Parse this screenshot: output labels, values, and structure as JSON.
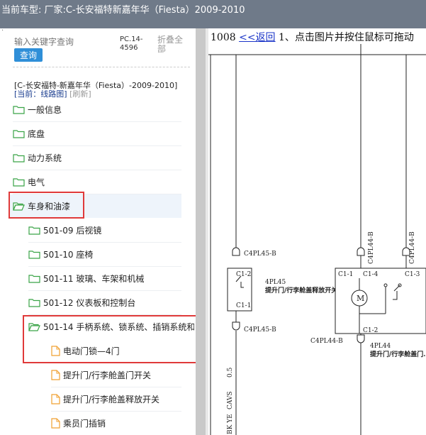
{
  "header": {
    "title": "当前车型:   厂家:C-长安福特新嘉年华（Fiesta）2009-2010"
  },
  "sidebar": {
    "dot": "·",
    "search": {
      "placeholder": "输入关键字查询",
      "button": "查询"
    },
    "pc_number": "PC.14-4596",
    "collapse_all": "折叠全部",
    "breadcrumb": "[C-长安福特-新嘉年华（Fiesta）-2009-2010]",
    "current_label": "[当前：线路图]",
    "refresh_label": "[刷新]",
    "tree": [
      {
        "label": "一般信息"
      },
      {
        "label": "底盘"
      },
      {
        "label": "动力系统"
      },
      {
        "label": "电气"
      },
      {
        "label": "车身和油漆"
      },
      {
        "label": "501-09 后视镜"
      },
      {
        "label": "501-10 座椅"
      },
      {
        "label": "501-11 玻璃、车架和机械"
      },
      {
        "label": "501-12 仪表板和控制台"
      },
      {
        "label": "501-14 手柄系统、锁系统、插销系统和…"
      },
      {
        "label": "电动门锁—4门"
      },
      {
        "label": "提升门/行李舱盖门开关"
      },
      {
        "label": "提升门/行李舱盖释放开关"
      },
      {
        "label": "乘员门插销"
      }
    ]
  },
  "content": {
    "page_no": "1008",
    "back_label": "<<返回",
    "instruction": "1、点击图片并按住鼠标可拖动"
  },
  "diagram": {
    "labels": {
      "c4pl45b_top": "C4PL45-B",
      "c4pl45b_bottom": "C4PL45-B",
      "c4pl44b_a": "C4PL44-B",
      "c4pl44b_b": "C4PL44-B",
      "c4pl44b_bottom": "C4PL44-B",
      "c12_left": "C1-2",
      "c11_left": "C1-1",
      "c11_right": "C1-1",
      "c14": "C1-4",
      "c13": "C1-3",
      "c12_right": "C1-2",
      "pl45_code": "4PL45",
      "pl45_name": "提升门/行李舱盖释放开关",
      "pl44_code": "4PL44",
      "pl44_name": "提升门/行李舱盖门…",
      "wire_size": "0.5",
      "wire_type": "CAVS",
      "wire_color": "BK YE",
      "motor": "M"
    }
  }
}
